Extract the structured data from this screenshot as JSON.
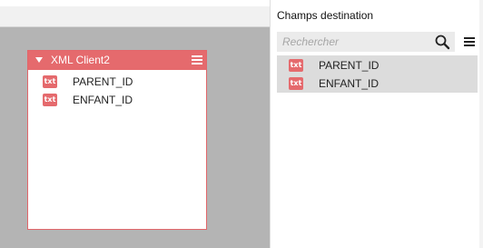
{
  "source_table": {
    "title": "XML Client2",
    "fields": [
      {
        "type_badge": "txt",
        "name": "PARENT_ID"
      },
      {
        "type_badge": "txt",
        "name": "ENFANT_ID"
      }
    ]
  },
  "destination_panel": {
    "title": "Champs destination",
    "search": {
      "placeholder": "Rechercher",
      "value": ""
    },
    "fields": [
      {
        "type_badge": "txt",
        "name": "PARENT_ID"
      },
      {
        "type_badge": "txt",
        "name": "ENFANT_ID"
      }
    ]
  },
  "colors": {
    "accent": "#e56a6d",
    "canvas_bg": "#b4b4b4",
    "selected_bg": "#dcdcdc"
  },
  "icons": {
    "collapse": "triangle-down-icon",
    "menu": "hamburger-menu-icon",
    "search": "magnifier-search-icon",
    "field_type": "txt-type-icon"
  }
}
